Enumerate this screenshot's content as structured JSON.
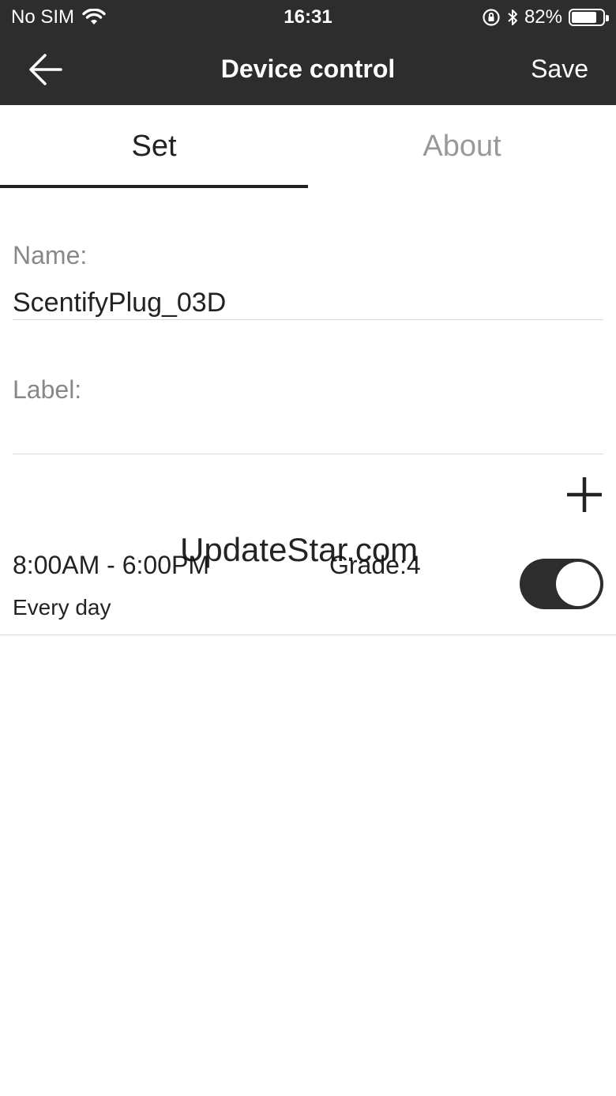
{
  "status_bar": {
    "carrier": "No SIM",
    "time": "16:31",
    "battery_percent": "82%",
    "battery_level": 0.82
  },
  "nav": {
    "title": "Device control",
    "save_label": "Save",
    "back_icon": "arrow-left-icon"
  },
  "tabs": [
    {
      "label": "Set",
      "active": true
    },
    {
      "label": "About",
      "active": false
    }
  ],
  "form": {
    "name_label": "Name:",
    "name_value": "ScentifyPlug_03D",
    "label_label": "Label:",
    "label_value": ""
  },
  "schedule": {
    "add_icon": "plus-icon",
    "items": [
      {
        "time": "8:00AM - 6:00PM",
        "grade": "Grade:4",
        "repeat": "Every day",
        "enabled": true
      }
    ]
  },
  "watermark": "UpdateStar.com",
  "colors": {
    "header_bg": "#2d2d2d",
    "active_tab": "#222222",
    "inactive_tab": "#999999",
    "toggle_on": "#2d2d2d"
  }
}
